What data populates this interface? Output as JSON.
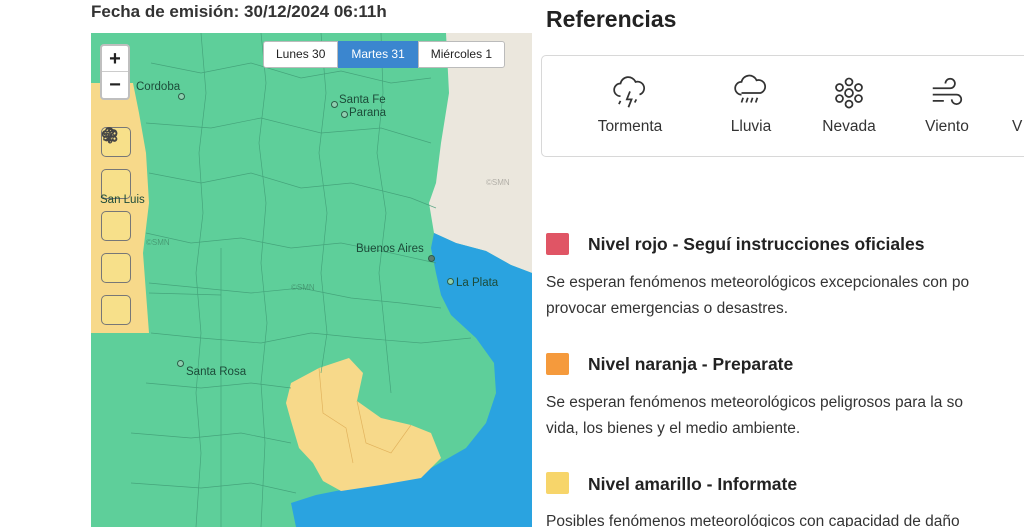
{
  "header": {
    "emission": "Fecha de emisión: 30/12/2024 06:11h"
  },
  "map": {
    "zoom_in": "+",
    "zoom_out": "−",
    "days": [
      {
        "label": "Lunes 30",
        "active": false
      },
      {
        "label": "Martes 31",
        "active": true
      },
      {
        "label": "Miércoles 1",
        "active": false
      }
    ],
    "cities": [
      {
        "name": "Cordoba"
      },
      {
        "name": "Santa Fe"
      },
      {
        "name": "Parana"
      },
      {
        "name": "San Luis"
      },
      {
        "name": "Buenos Aires"
      },
      {
        "name": "La Plata"
      },
      {
        "name": "Santa Rosa"
      }
    ],
    "watermark": "©SMN",
    "colors": {
      "green": "#5ecf9a",
      "yellow": "#f7d98a",
      "water": "#2aa3e0",
      "land": "#ebe7dd"
    },
    "hazard_icons": [
      "storm-icon",
      "rain-icon",
      "snow-icon",
      "wind-icon",
      "heat-icon"
    ]
  },
  "references": {
    "title": "Referencias",
    "items": [
      {
        "label": "Tormenta",
        "icon": "storm-icon"
      },
      {
        "label": "Lluvia",
        "icon": "rain-icon"
      },
      {
        "label": "Nevada",
        "icon": "snow-icon"
      },
      {
        "label": "Viento",
        "icon": "wind-icon"
      }
    ]
  },
  "levels": [
    {
      "title": "Nivel rojo - Seguí instrucciones oficiales",
      "color": "#e05565",
      "desc1": "Se esperan fenómenos meteorológicos excepcionales con po",
      "desc2": "provocar emergencias o desastres."
    },
    {
      "title": "Nivel naranja - Preparate",
      "color": "#f59a3c",
      "desc1": "Se esperan fenómenos meteorológicos peligrosos para la so",
      "desc2": "vida, los bienes y el medio ambiente."
    },
    {
      "title": "Nivel amarillo - Informate",
      "color": "#f7d56a",
      "desc1": "Posibles fenómenos meteorológicos con capacidad de daño"
    }
  ]
}
